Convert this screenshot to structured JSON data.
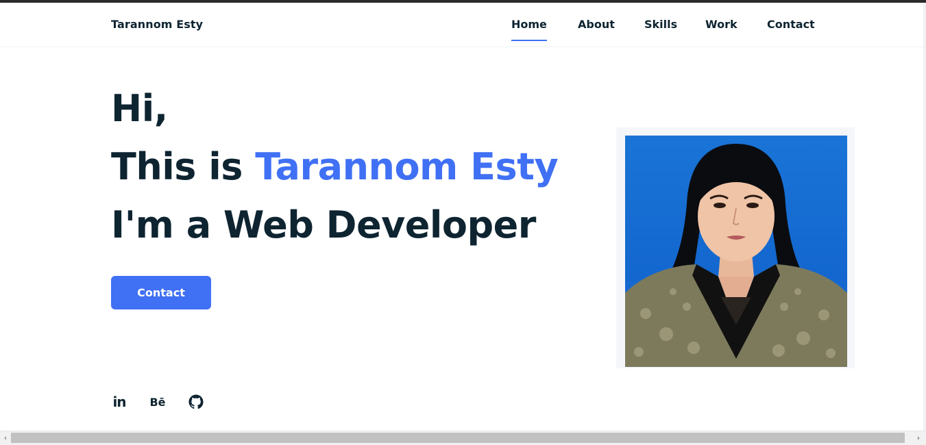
{
  "header": {
    "logo": "Tarannom Esty",
    "nav": [
      {
        "label": "Home",
        "active": true
      },
      {
        "label": "About",
        "active": false
      },
      {
        "label": "Skills",
        "active": false
      },
      {
        "label": "Work",
        "active": false
      },
      {
        "label": "Contact",
        "active": false
      }
    ]
  },
  "hero": {
    "line1": "Hi,",
    "line2_prefix": "This is ",
    "line2_name": "Tarannom Esty",
    "line3": "I'm a Web Developer",
    "cta_label": "Contact"
  },
  "social": [
    {
      "icon": "linkedin-icon",
      "text": "in"
    },
    {
      "icon": "behance-icon",
      "text": "Bē"
    },
    {
      "icon": "github-icon",
      "text": ""
    }
  ],
  "colors": {
    "accent": "#4070f4",
    "text": "#0e2431",
    "photo_background": "#1a74d6"
  }
}
